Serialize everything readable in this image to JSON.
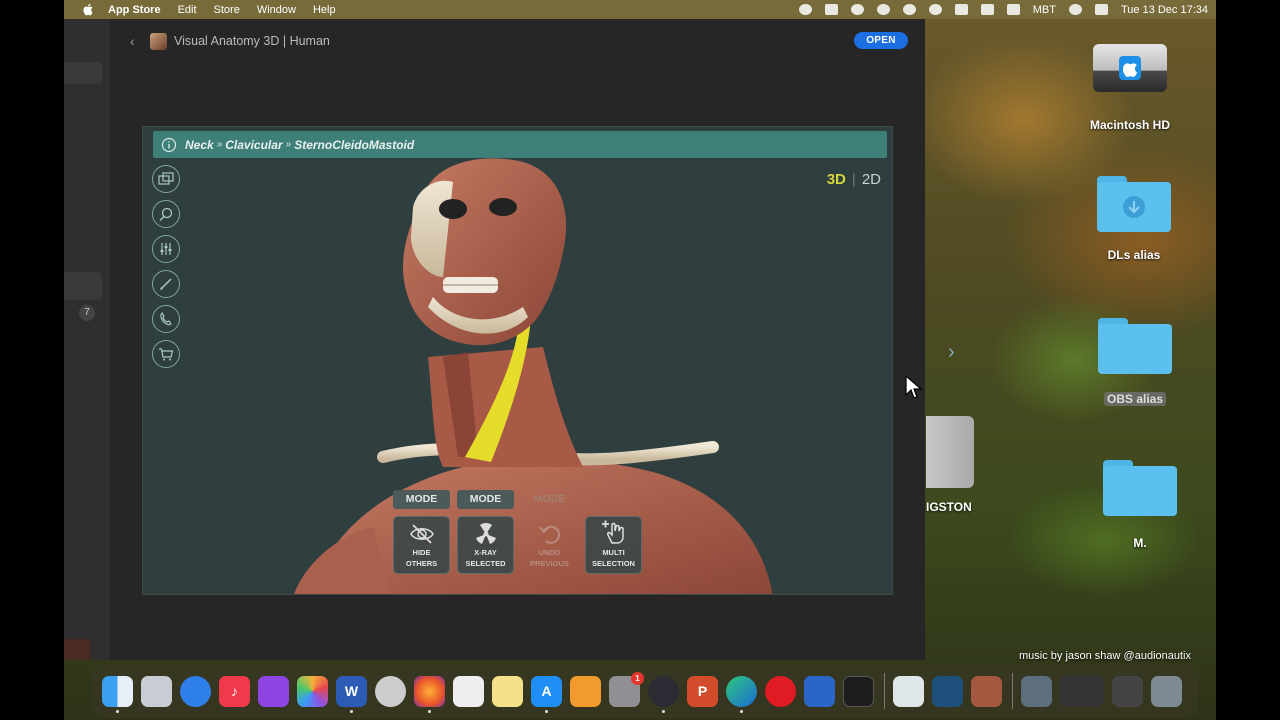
{
  "menubar": {
    "app_name": "App Store",
    "menus": [
      "Edit",
      "Store",
      "Window",
      "Help"
    ],
    "input_source": "MBT",
    "datetime": "Tue 13 Dec  17:34"
  },
  "sidebar": {
    "badge": "7"
  },
  "app_page": {
    "title": "Visual Anatomy 3D | Human",
    "open_label": "OPEN"
  },
  "screenshot": {
    "breadcrumb": [
      "Neck",
      "Clavicular",
      "SternoCleidoMastoid"
    ],
    "breadcrumb_separator": "»",
    "view_3d": "3D",
    "view_2d": "2D",
    "tools": [
      "layers-icon",
      "search-icon",
      "sliders-icon",
      "pen-icon",
      "phone-icon",
      "cart-icon"
    ],
    "mode_labels": [
      "MODE",
      "MODE",
      "MODE"
    ],
    "mode_buttons": [
      {
        "line1": "HIDE",
        "line2": "OTHERS"
      },
      {
        "line1": "X-RAY",
        "line2": "SELECTED"
      },
      {
        "line1": "UNDO",
        "line2": "PREVIOUS"
      },
      {
        "line1": "MULTI",
        "line2": "SELECTION"
      }
    ],
    "highlight_color": "#e6dc2a",
    "accent_color": "#3e7f78"
  },
  "desktop": {
    "icons": [
      {
        "label": "Macintosh HD"
      },
      {
        "label": "DLs alias"
      },
      {
        "label": "OBS alias"
      },
      {
        "label": "M."
      }
    ],
    "partial_drive_label": "IGSTON",
    "credit": "music by jason shaw @audionautix"
  },
  "dock": {
    "apps": [
      "Finder",
      "Launchpad",
      "Safari",
      "Music",
      "Podcasts",
      "Photos",
      "Word",
      "Vectorize",
      "Firefox",
      "TextEdit",
      "Notes",
      "App Store",
      "Books",
      "System Preferences",
      "OBS",
      "PowerPoint",
      "Edge",
      "Opera",
      "Mission Control",
      "Activity Monitor"
    ],
    "settings_badge": "1",
    "recent": [
      "Organon",
      "Student Anatomy",
      "Visual Anatomy"
    ]
  }
}
